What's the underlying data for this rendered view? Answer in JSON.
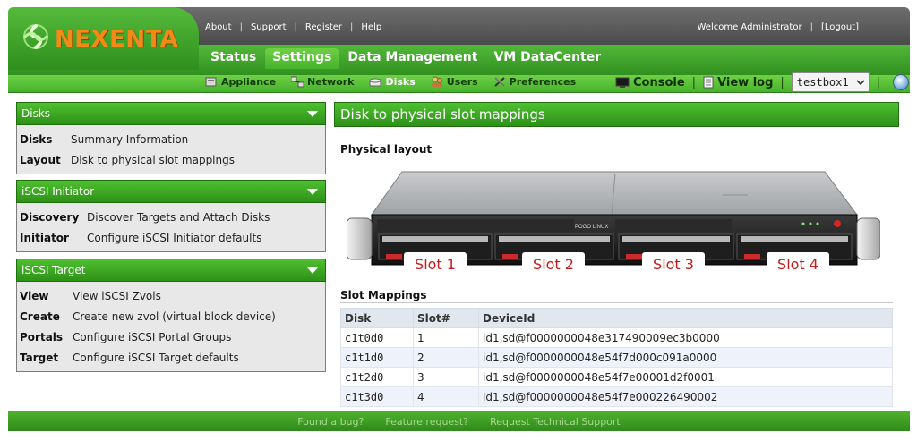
{
  "brand": {
    "logo_text": "NEXENTA"
  },
  "top_links": [
    "About",
    "Support",
    "Register",
    "Help"
  ],
  "welcome": {
    "text": "Welcome Administrator",
    "logout": "[Logout]"
  },
  "main_tabs": [
    {
      "label": "Status"
    },
    {
      "label": "Settings",
      "active": true
    },
    {
      "label": "Data Management"
    },
    {
      "label": "VM DataCenter"
    }
  ],
  "sub_tabs": [
    {
      "label": "Appliance",
      "icon": "appliance-icon"
    },
    {
      "label": "Network",
      "icon": "network-icon"
    },
    {
      "label": "Disks",
      "icon": "disks-icon",
      "active": true
    },
    {
      "label": "Users",
      "icon": "users-icon"
    },
    {
      "label": "Preferences",
      "icon": "preferences-icon"
    }
  ],
  "tools": {
    "console": "Console",
    "view_log": "View log",
    "host": "testbox1"
  },
  "sidebar": {
    "panels": [
      {
        "title": "Disks",
        "items": [
          {
            "key": "Disks",
            "desc": "Summary Information"
          },
          {
            "key": "Layout",
            "desc": "Disk to physical slot mappings"
          }
        ]
      },
      {
        "title": "iSCSI Initiator",
        "items": [
          {
            "key": "Discovery",
            "desc": "Discover Targets and Attach Disks"
          },
          {
            "key": "Initiator",
            "desc": "Configure iSCSI Initiator defaults"
          }
        ]
      },
      {
        "title": "iSCSI Target",
        "items": [
          {
            "key": "View",
            "desc": "View iSCSI Zvols"
          },
          {
            "key": "Create",
            "desc": "Create new zvol (virtual block device)"
          },
          {
            "key": "Portals",
            "desc": "Configure iSCSI Portal Groups"
          },
          {
            "key": "Target",
            "desc": "Configure iSCSI Target defaults"
          }
        ]
      }
    ]
  },
  "main": {
    "title": "Disk to physical slot mappings",
    "physical_layout_label": "Physical layout",
    "server_badge": "POGO LINUX",
    "slots": [
      "Slot 1",
      "Slot 2",
      "Slot 3",
      "Slot 4"
    ],
    "slot_mappings_label": "Slot Mappings",
    "table": {
      "headers": [
        "Disk",
        "Slot#",
        "DeviceId"
      ],
      "rows": [
        [
          "c1t0d0",
          "1",
          "id1,sd@f0000000048e317490009ec3b0000"
        ],
        [
          "c1t1d0",
          "2",
          "id1,sd@f0000000048e54f7d000c091a0000"
        ],
        [
          "c1t2d0",
          "3",
          "id1,sd@f0000000048e54f7e00001d2f0001"
        ],
        [
          "c1t3d0",
          "4",
          "id1,sd@f0000000048e54f7e000226490002"
        ]
      ]
    }
  },
  "footer": {
    "links": [
      "Found a bug?",
      "Feature request?",
      "Request Technical Support"
    ]
  },
  "colors": {
    "brand_green": "#3aa320",
    "logo_orange": "#f28a16",
    "header_dark": "#555555",
    "slot_red": "#c61a1a"
  }
}
